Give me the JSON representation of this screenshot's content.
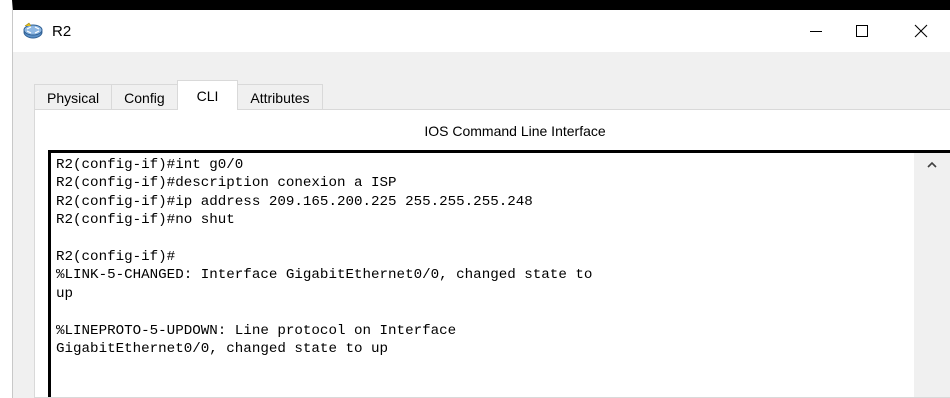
{
  "window": {
    "title": "R2",
    "controls": {
      "minimize": "minimize",
      "maximize": "maximize",
      "close": "close"
    }
  },
  "tabs": [
    {
      "label": "Physical",
      "active": false
    },
    {
      "label": "Config",
      "active": false
    },
    {
      "label": "CLI",
      "active": true
    },
    {
      "label": "Attributes",
      "active": false
    }
  ],
  "cli": {
    "heading": "IOS Command Line Interface",
    "lines": [
      "R2(config-if)#int g0/0",
      "R2(config-if)#description conexion a ISP",
      "R2(config-if)#ip address 209.165.200.225 255.255.255.248",
      "R2(config-if)#no shut",
      "",
      "R2(config-if)#",
      "%LINK-5-CHANGED: Interface GigabitEthernet0/0, changed state to",
      "up",
      "",
      "%LINEPROTO-5-UPDOWN: Line protocol on Interface",
      "GigabitEthernet0/0, changed state to up"
    ]
  },
  "icons": {
    "app": "router-icon",
    "scroll_up": "chevron-up-icon"
  }
}
